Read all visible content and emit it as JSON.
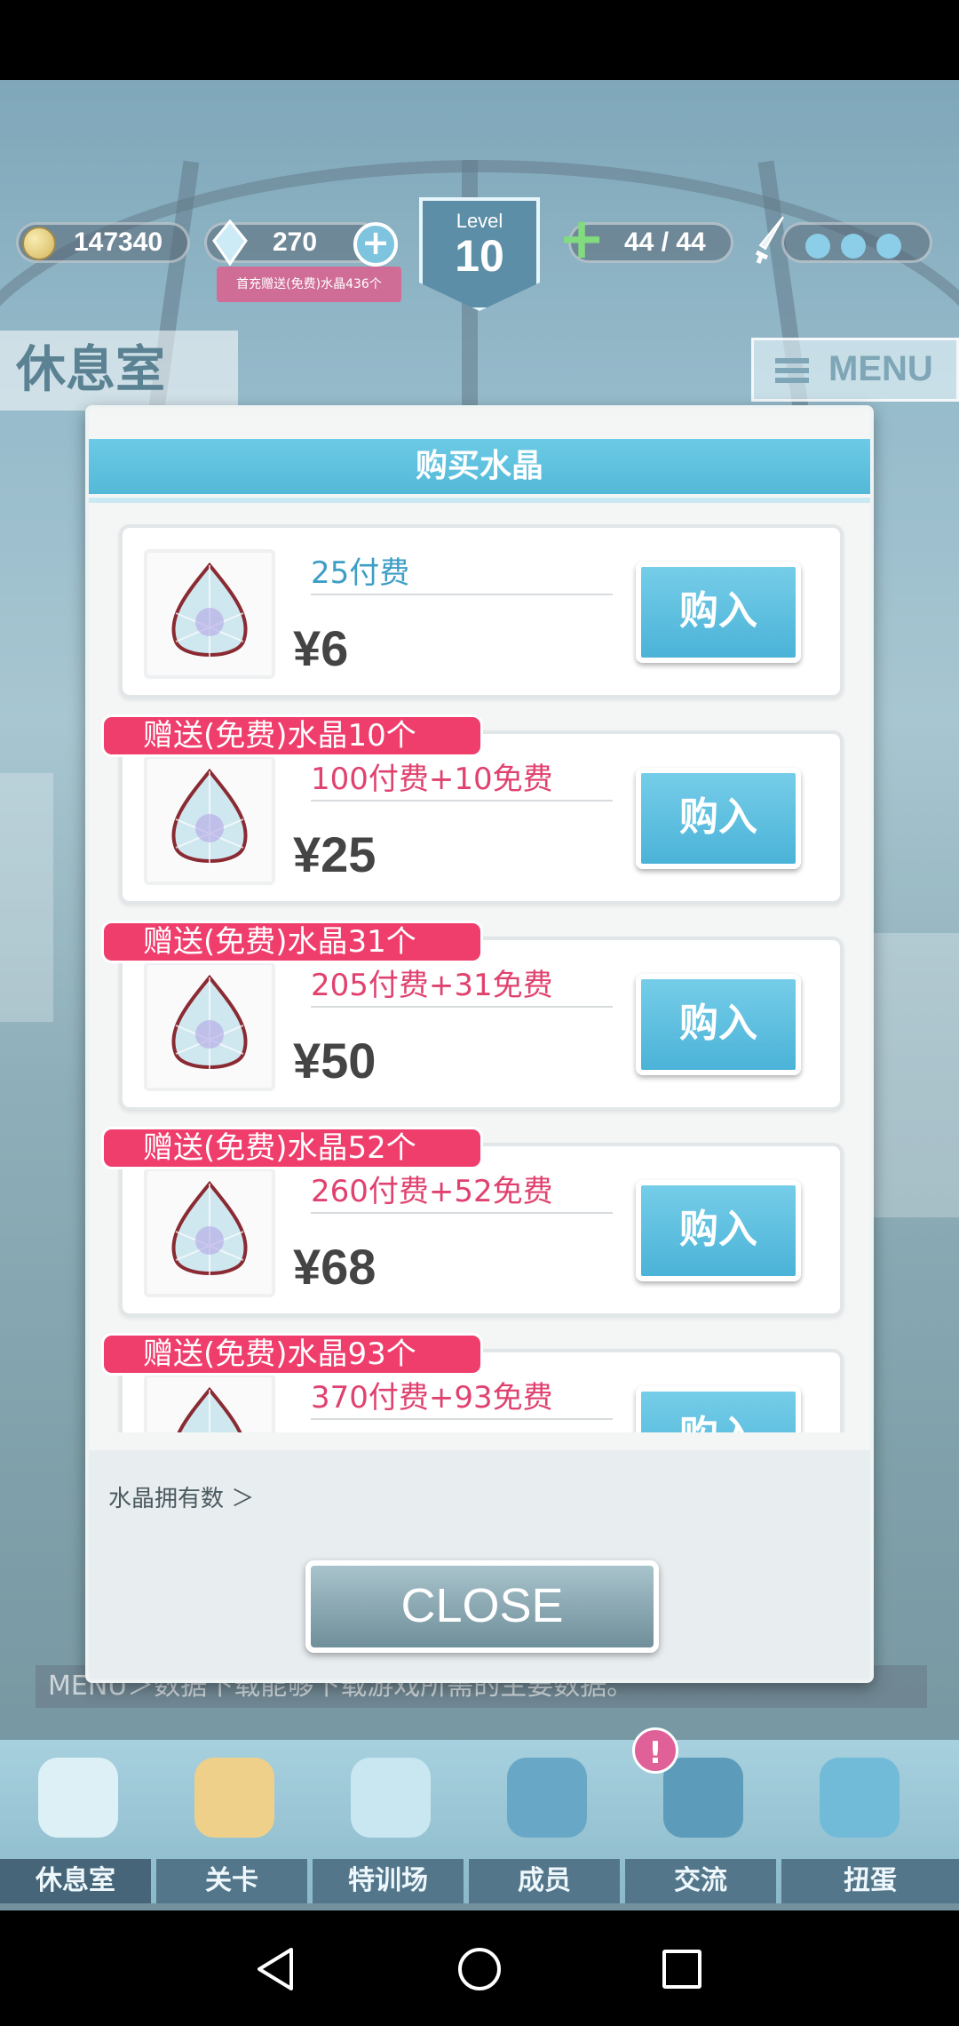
{
  "hud": {
    "coins": "147340",
    "gems": "270",
    "promo": "首充赠送(免费)水晶436个",
    "level_label": "Level",
    "level": "10",
    "stamina": "44 / 44"
  },
  "room_title": "休息室",
  "menu_label": "MENU",
  "marquee": "MENU＞数据下载能够下载游戏所需的主要数据。",
  "bottom_nav": [
    {
      "label": "休息室",
      "icon": "building-icon",
      "active": true
    },
    {
      "label": "关卡",
      "icon": "mask-icon",
      "active": false
    },
    {
      "label": "特训场",
      "icon": "crossed-swords-icon",
      "active": false
    },
    {
      "label": "成员",
      "icon": "cat-face-icon",
      "active": false
    },
    {
      "label": "交流",
      "icon": "dress-icon",
      "active": false
    },
    {
      "label": "扭蛋",
      "icon": "curtain-icon",
      "active": false
    }
  ],
  "alert_badge": "!",
  "modal": {
    "title": "购买水晶",
    "buy_label": "购入",
    "owned_label": "水晶拥有数 ＞",
    "close_label": "CLOSE",
    "items": [
      {
        "desc": "25付费",
        "price": "¥6",
        "bonus": null
      },
      {
        "desc": "100付费+10免费",
        "price": "¥25",
        "bonus": "赠送(免费)水晶10个"
      },
      {
        "desc": "205付费+31免费",
        "price": "¥50",
        "bonus": "赠送(免费)水晶31个"
      },
      {
        "desc": "260付费+52免费",
        "price": "¥68",
        "bonus": "赠送(免费)水晶52个"
      },
      {
        "desc": "370付费+93免费",
        "price": "",
        "bonus": "赠送(免费)水晶93个"
      }
    ]
  },
  "colors": {
    "accent_blue": "#53b8d7",
    "bonus_pink": "#ef3d6c",
    "desc_pink": "#e0426f",
    "desc_blue": "#3d9ec6"
  }
}
